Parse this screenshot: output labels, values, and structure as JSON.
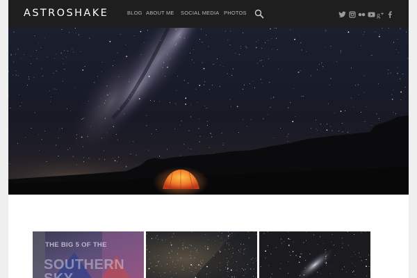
{
  "site": {
    "logo": "ASTROSHAKE"
  },
  "nav": {
    "items": [
      {
        "label": "BLOG"
      },
      {
        "label": "ABOUT ME"
      },
      {
        "label": "SOCIAL MEDIA"
      },
      {
        "label": "PHOTOS"
      }
    ],
    "search_icon": "search-icon",
    "social_icons": [
      "twitter-icon",
      "instagram-icon",
      "flickr-icon",
      "youtube-icon",
      "google-plus-icon",
      "facebook-icon"
    ]
  },
  "hero": {
    "image": "milky-way-over-tent-photo"
  },
  "thumbnails": [
    {
      "title_line1": "THE BIG 5 OF THE",
      "title_line2": "SOUTHERN SKY"
    },
    {
      "image": "star-field-photo"
    },
    {
      "image": "galaxy-photo"
    }
  ],
  "colors": {
    "navbar_bg": "#1e1e1f",
    "nav_text": "#b9b9b9",
    "logo_text": "#ffffff",
    "page_bg": "#efefef",
    "content_bg": "#ffffff",
    "tent": "#e8552a"
  }
}
